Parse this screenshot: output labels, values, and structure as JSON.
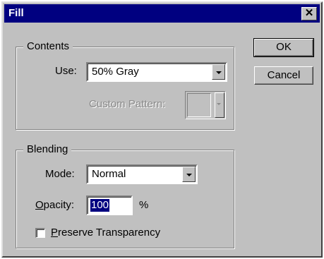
{
  "dialog": {
    "title": "Fill",
    "close_glyph": "✕"
  },
  "contents": {
    "legend": "Contents",
    "use_label": "Use:",
    "use_value": "50% Gray",
    "custom_pattern_label": "Custom Pattern:"
  },
  "blending": {
    "legend": "Blending",
    "mode_label": "Mode:",
    "mode_value": "Normal",
    "opacity_label_first": "O",
    "opacity_label_rest": "pacity:",
    "opacity_value": "100",
    "opacity_unit": "%",
    "preserve_first": "P",
    "preserve_rest": "reserve Transparency",
    "preserve_checked": false
  },
  "buttons": {
    "ok": "OK",
    "cancel": "Cancel"
  }
}
